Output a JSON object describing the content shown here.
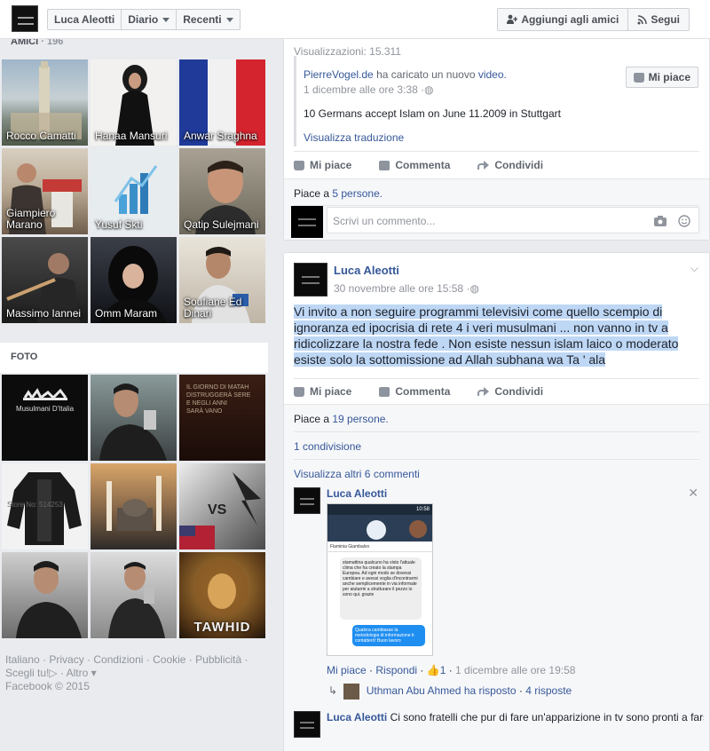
{
  "topbar": {
    "profile_name": "Luca Aleotti",
    "diario": "Diario",
    "recenti": "Recenti",
    "add_friend": "Aggiungi agli amici",
    "follow": "Segui"
  },
  "left": {
    "friends_title": "AMICI",
    "friends_count": "196",
    "friends": [
      {
        "name": "Rocco Camatti"
      },
      {
        "name": "Hanaa Mansuri"
      },
      {
        "name": "Anwar Sraghna"
      },
      {
        "name": "Giampiero Marano"
      },
      {
        "name": "Yusuf Skti"
      },
      {
        "name": "Qatip Sulejmani"
      },
      {
        "name": "Massimo Iannei"
      },
      {
        "name": "Omm Maram"
      },
      {
        "name": "Soufiane Ed Dinari"
      }
    ],
    "photos_title": "FOTO",
    "photo_text_1": "Musulmani D'Italia",
    "photo_text_2": "VS",
    "photo_text_3": "TAWHID",
    "photo_text_4": "Store No: 514253",
    "footer_links": [
      "Italiano",
      "Privacy",
      "Condizioni",
      "Cookie",
      "Pubblicità"
    ],
    "footer_line2": [
      "Scegli tu!",
      "Altro"
    ],
    "copyright": "Facebook © 2015"
  },
  "post1": {
    "views": "Visualizzazioni: 15.311",
    "uploader": "PierreVogel.de",
    "upload_text": "ha caricato un nuovo",
    "upload_link": "video.",
    "date": "1 dicembre alle ore 3:38",
    "title": "10 Germans accept Islam on June 11.2009 in Stuttgart",
    "translate": "Visualizza traduzione",
    "page_like": "Mi piace",
    "like": "Mi piace",
    "comment": "Commenta",
    "share": "Condividi",
    "likes_prefix": "Piace a",
    "likes_link": "5 persone.",
    "comment_placeholder": "Scrivi un commento..."
  },
  "post2": {
    "author": "Luca Aleotti",
    "date": "30 novembre alle ore 15:58",
    "text": "Vi invito a non seguire programmi televisivi come quello scempio di ignoranza ed ipocrisia di rete 4 i veri musulmani ... non vanno in tv a ridicolizzare la nostra fede . Non esiste nessun islam laico o moderato esiste solo la sottomissione ad Allah subhana wa Ta ' ala",
    "like": "Mi piace",
    "comment": "Commenta",
    "share": "Condividi",
    "likes_prefix": "Piace a",
    "likes_link": "19 persone.",
    "shares": "1 condivisione",
    "more_comments": "Visualizza altri 6 commenti",
    "comment1": {
      "author": "Luca Aleotti",
      "like": "Mi piace",
      "reply": "Rispondi",
      "like_count": "1",
      "date": "1 dicembre alle ore 19:58",
      "screenshot_time": "10:58",
      "screenshot_contact": "Flaminia Giambalvo",
      "screenshot_msg": "stamattina qualcuno ha visto l'attuale clima che ha creato la stampa Europea. Ad ogni modo se dovessi cambiare e avessi voglia d'incontrarmi anche semplicemente in via informale per aiutarmi a strutturare il pezzo io sono qui. grazie",
      "screenshot_reply": "Qualora cambiasse la metodologia di informazione ti contatterò! Buon lavoro"
    },
    "reply_author": "Uthman Abu Ahmed",
    "reply_text": "ha risposto",
    "reply_count": "4 risposte",
    "comment2_author": "Luca Aleotti",
    "comment2_text": "Ci sono fratelli che pur di fare un'apparizione in tv sono pronti a farsi"
  }
}
